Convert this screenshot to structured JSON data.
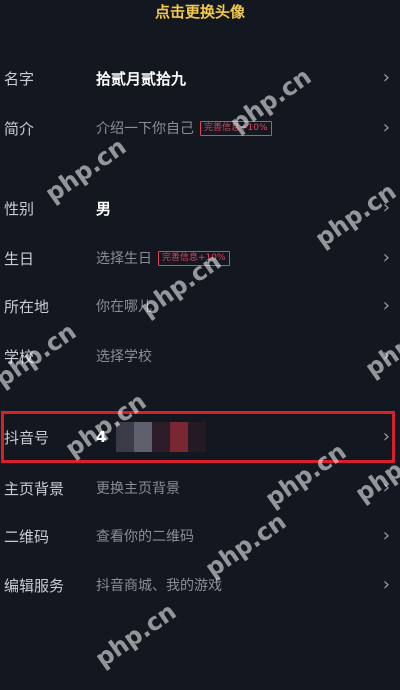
{
  "header": {
    "change_avatar": "点击更换头像"
  },
  "rows": [
    {
      "label": "名字",
      "value": "拾贰月贰拾九"
    },
    {
      "label": "简介",
      "value": "介绍一下你自己",
      "badge": "完善信息+10%"
    },
    {
      "label": "性别",
      "value": "男"
    },
    {
      "label": "生日",
      "value": "选择生日",
      "badge": "完善信息+10%"
    },
    {
      "label": "所在地",
      "value": "你在哪儿"
    },
    {
      "label": "学校",
      "value": "选择学校"
    },
    {
      "label": "抖音号",
      "value": "4"
    },
    {
      "label": "主页背景",
      "value": "更换主页背景"
    },
    {
      "label": "二维码",
      "value": "查看你的二维码"
    },
    {
      "label": "编辑服务",
      "value": "抖音商城、我的游戏"
    }
  ],
  "chevron": "›",
  "watermark": "php.cn",
  "colors": {
    "background": "#131720",
    "accent": "#f2c84b",
    "badge": "#e0435a",
    "highlight": "#d8202b"
  },
  "icons": {
    "chevron": "chevron-right-icon"
  }
}
